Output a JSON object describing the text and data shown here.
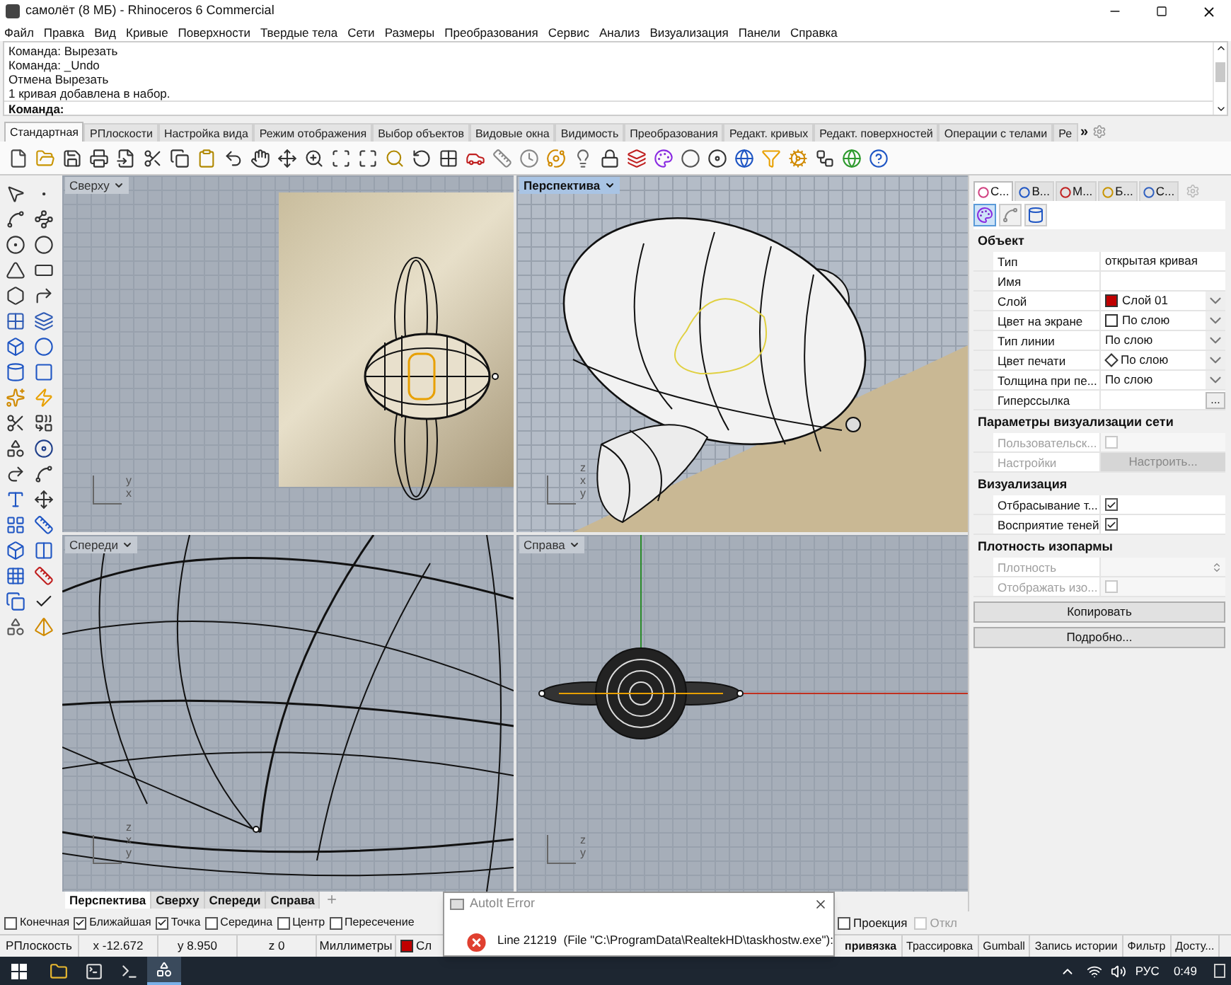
{
  "window": {
    "title": "самолёт (8 МБ) - Rhinoceros 6 Commercial"
  },
  "menu": [
    "Файл",
    "Правка",
    "Вид",
    "Кривые",
    "Поверхности",
    "Твердые тела",
    "Сети",
    "Размеры",
    "Преобразования",
    "Сервис",
    "Анализ",
    "Визуализация",
    "Панели",
    "Справка"
  ],
  "command_history": [
    "Команда: Вырезать",
    "Команда: _Undo",
    "Отмена Вырезать",
    "1 кривая добавлена в набор."
  ],
  "command_prompt": {
    "label": "Команда:"
  },
  "toolbar_tabs": [
    {
      "label": "Стандартная",
      "selected": true
    },
    {
      "label": "РПлоскости",
      "selected": false
    },
    {
      "label": "Настройка вида",
      "selected": false
    },
    {
      "label": "Режим отображения",
      "selected": false
    },
    {
      "label": "Выбор объектов",
      "selected": false
    },
    {
      "label": "Видовые окна",
      "selected": false
    },
    {
      "label": "Видимость",
      "selected": false
    },
    {
      "label": "Преобразования",
      "selected": false
    },
    {
      "label": "Редакт. кривых",
      "selected": false
    },
    {
      "label": "Редакт. поверхностей",
      "selected": false
    },
    {
      "label": "Операции с телами",
      "selected": false
    },
    {
      "label": "Ре",
      "selected": false
    }
  ],
  "toolbar_overflow": "»",
  "viewports": [
    {
      "title": "Сверху",
      "active": false,
      "kind": "top",
      "axes": [
        "y",
        "x"
      ]
    },
    {
      "title": "Перспектива",
      "active": true,
      "kind": "perspective",
      "axes": [
        "z",
        "x",
        "y"
      ]
    },
    {
      "title": "Спереди",
      "active": false,
      "kind": "front",
      "axes": [
        "z",
        "x",
        "y"
      ]
    },
    {
      "title": "Справа",
      "active": false,
      "kind": "right",
      "axes": [
        "z",
        "y"
      ]
    }
  ],
  "viewport_tabs": [
    {
      "label": "Перспектива",
      "selected": true
    },
    {
      "label": "Сверху",
      "selected": false
    },
    {
      "label": "Спереди",
      "selected": false
    },
    {
      "label": "Справа",
      "selected": false
    }
  ],
  "panel": {
    "tabs": [
      {
        "label": "С...",
        "selected": true
      },
      {
        "label": "В...",
        "selected": false
      },
      {
        "label": "М...",
        "selected": false
      },
      {
        "label": "Б...",
        "selected": false
      },
      {
        "label": "С...",
        "selected": false
      }
    ],
    "subtabs": [
      {
        "selected": true
      },
      {
        "selected": false
      },
      {
        "selected": false
      }
    ],
    "sections": [
      {
        "title": "Объект",
        "rows": [
          {
            "label": "Тип",
            "kind": "text",
            "value": "открытая кривая",
            "disabled": false
          },
          {
            "label": "Имя",
            "kind": "text",
            "disabled": false
          },
          {
            "label": "Слой",
            "kind": "swatch",
            "value": "Слой 01",
            "color": "#c00000",
            "disabled": false
          },
          {
            "label": "Цвет на экране",
            "kind": "swatch",
            "value": "По слою",
            "color": "#ffffff",
            "disabled": false
          },
          {
            "label": "Тип линии",
            "kind": "dropdown",
            "value": "По слою",
            "disabled": false
          },
          {
            "label": "Цвет печати",
            "kind": "diamond",
            "value": "По слою",
            "disabled": false
          },
          {
            "label": "Толщина при пе...",
            "kind": "dropdown",
            "value": "По слою",
            "disabled": false
          },
          {
            "label": "Гиперссылка",
            "kind": "ellipsis",
            "value": "...",
            "disabled": false
          }
        ]
      },
      {
        "title": "Параметры визуализации сети",
        "rows": [
          {
            "label": "Пользовательск...",
            "kind": "checkbox",
            "checked": false,
            "disabled": true
          },
          {
            "label": "Настройки",
            "kind": "button",
            "value": "Настроить...",
            "disabled": true
          }
        ]
      },
      {
        "title": "Визуализация",
        "rows": [
          {
            "label": "Отбрасывание т...",
            "kind": "checkbox",
            "checked": true,
            "disabled": false
          },
          {
            "label": "Восприятие теней",
            "kind": "checkbox",
            "checked": true,
            "disabled": false
          }
        ]
      },
      {
        "title": "Плотность изопармы",
        "rows": [
          {
            "label": "Плотность",
            "kind": "spinner",
            "disabled": true
          },
          {
            "label": "Отображать изо...",
            "kind": "checkbox",
            "checked": false,
            "disabled": true
          }
        ]
      }
    ],
    "buttons": [
      "Копировать",
      "Подробно..."
    ]
  },
  "osnaps_left": [
    {
      "label": "Конечная",
      "checked": false,
      "disabled": false
    },
    {
      "label": "Ближайшая",
      "checked": true,
      "disabled": false
    },
    {
      "label": "Точка",
      "checked": true,
      "disabled": false
    },
    {
      "label": "Середина",
      "checked": false,
      "disabled": false
    },
    {
      "label": "Центр",
      "checked": false,
      "disabled": false
    },
    {
      "label": "Пересечение",
      "checked": false,
      "disabled": false
    }
  ],
  "osnaps_right": [
    {
      "label": "Проекция",
      "checked": false,
      "disabled": false
    },
    {
      "label": "Откл",
      "checked": false,
      "disabled": true
    }
  ],
  "status_left": [
    "РПлоскость",
    "x -12.672",
    "y 8.950",
    "z 0",
    "Миллиметры"
  ],
  "status_layer": {
    "label": "Сл",
    "color": "#c00000"
  },
  "status_right": [
    "привязка",
    "Трассировка",
    "Gumball",
    "Запись истории",
    "Фильтр",
    "Досту..."
  ],
  "dialog": {
    "title": "AutoIt Error",
    "message": "Line 21219  (File \"C:\\ProgramData\\RealtekHD\\taskhostw.exe\"):"
  },
  "taskbar": {
    "language": "РУС",
    "time": "0:49"
  }
}
